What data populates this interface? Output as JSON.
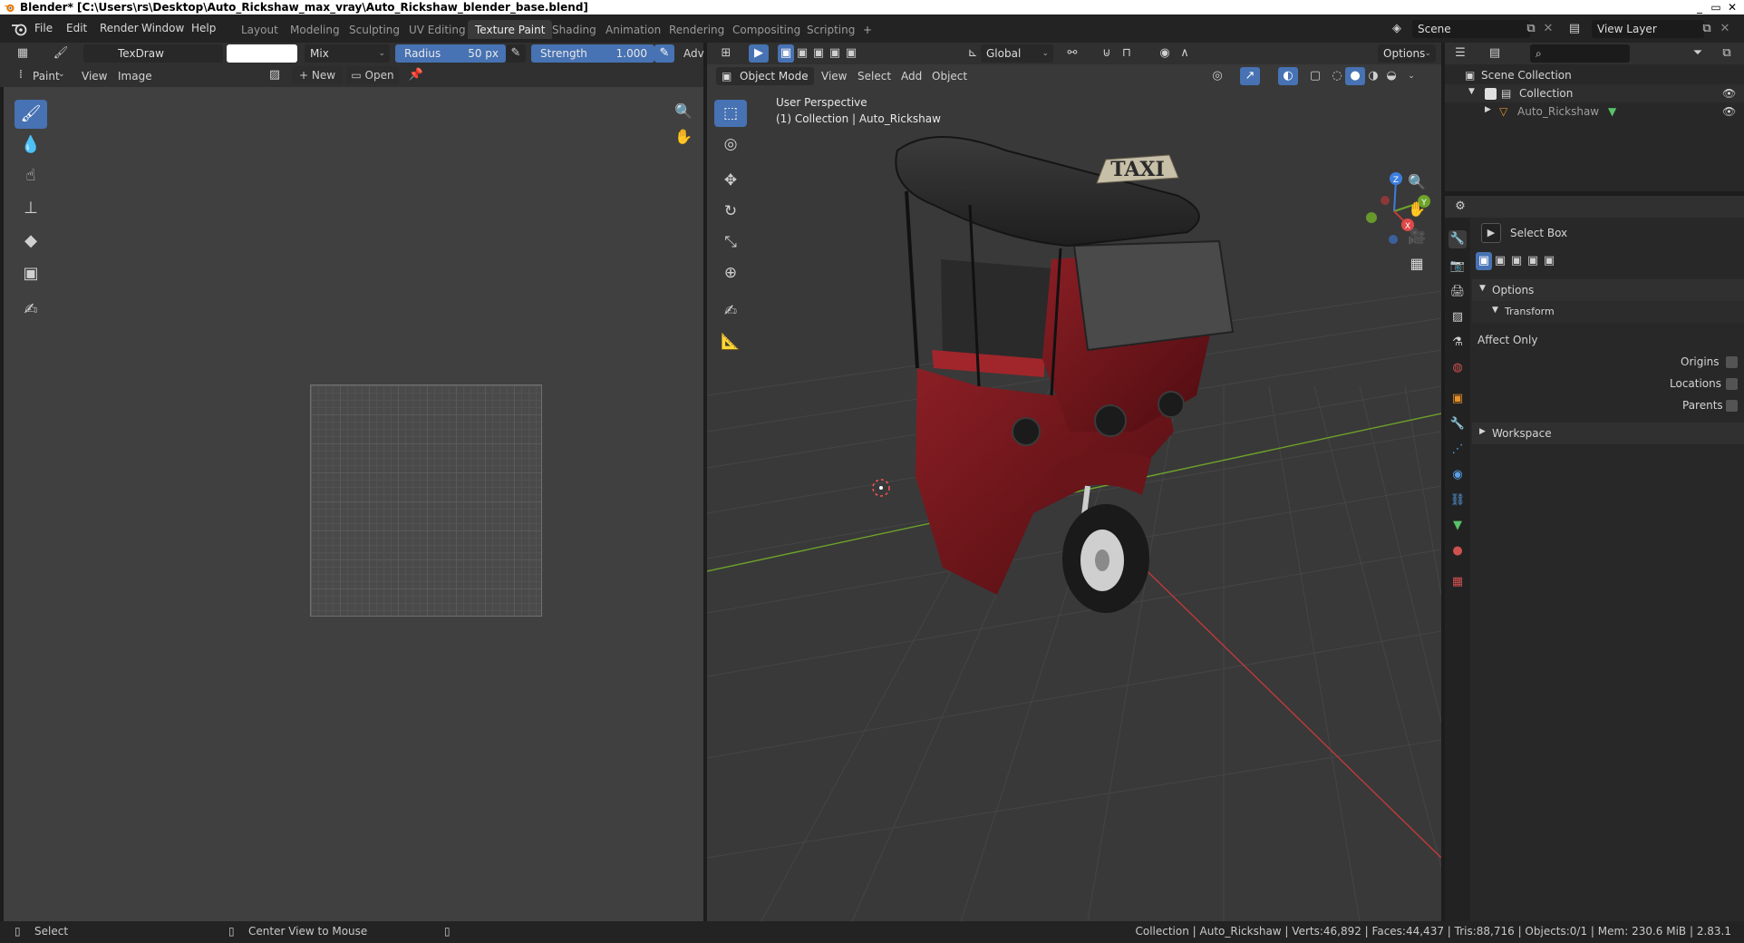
{
  "window": {
    "title": "Blender* [C:\\Users\\rs\\Desktop\\Auto_Rickshaw_max_vray\\Auto_Rickshaw_blender_base.blend]",
    "minimize": "_",
    "maximize": "▭",
    "close": "✕"
  },
  "menu": [
    "File",
    "Edit",
    "Render",
    "Window",
    "Help"
  ],
  "workspaces": [
    {
      "label": "Layout",
      "active": false
    },
    {
      "label": "Modeling",
      "active": false
    },
    {
      "label": "Sculpting",
      "active": false
    },
    {
      "label": "UV Editing",
      "active": false
    },
    {
      "label": "Texture Paint",
      "active": true
    },
    {
      "label": "Shading",
      "active": false
    },
    {
      "label": "Animation",
      "active": false
    },
    {
      "label": "Rendering",
      "active": false
    },
    {
      "label": "Compositing",
      "active": false
    },
    {
      "label": "Scripting",
      "active": false
    }
  ],
  "add_workspace": "+",
  "scene": {
    "label": "Scene"
  },
  "view_layer": {
    "label": "View Layer"
  },
  "brush_header": {
    "brush_name": "TexDraw",
    "blend_mode": "Mix",
    "radius_label": "Radius",
    "radius_value": "50 px",
    "strength_label": "Strength",
    "strength_value": "1.000",
    "strength_fraction": 1.0,
    "advanced": "Adv"
  },
  "image_header": {
    "mode": "Paint",
    "view": "View",
    "image": "Image",
    "new": "New",
    "open": "Open"
  },
  "viewport_header": {
    "orientation": "Global",
    "options": "Options",
    "object_mode": "Object Mode",
    "view": "View",
    "select": "Select",
    "add": "Add",
    "object": "Object"
  },
  "viewport": {
    "perspective": "User Perspective",
    "collection_info": "(1) Collection | Auto_Rickshaw",
    "sign_text": "TAXI",
    "gizmo": {
      "z": "Z",
      "y": "Y",
      "x": "X"
    }
  },
  "outliner": {
    "root": "Scene Collection",
    "collection": "Collection",
    "object": "Auto_Rickshaw"
  },
  "properties": {
    "tool_name": "Select Box",
    "options_label": "Options",
    "transform_label": "Transform",
    "affect_only": "Affect Only",
    "origins": "Origins",
    "locations": "Locations",
    "parents": "Parents",
    "workspace_label": "Workspace"
  },
  "statusbar": {
    "select": "Select",
    "center_view": "Center View to Mouse",
    "stats": "Collection | Auto_Rickshaw | Verts:46,892 | Faces:44,437 | Tris:88,716 | Objects:0/1 | Mem: 230.6 MiB | 2.83.1"
  },
  "colors": {
    "accent": "#4772b3",
    "axis_x": "#c23a3a",
    "axis_y": "#6ea32a",
    "rickshaw_body": "#7a1a1f",
    "canopy": "#2e2e2e"
  }
}
